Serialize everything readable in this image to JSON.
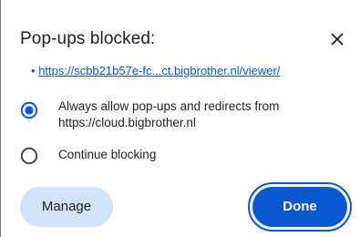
{
  "dialog": {
    "title": "Pop-ups blocked:",
    "close_icon": "close-icon",
    "blocked_link": {
      "bullet": "•",
      "text": "https://scbb21b57e-fc...ct.bigbrother.nl/viewer/"
    },
    "options": [
      {
        "line1": "Always allow pop-ups and redirects from",
        "line2": "https://cloud.bigbrother.nl",
        "selected": true
      },
      {
        "line1": "Continue blocking",
        "selected": false
      }
    ],
    "buttons": {
      "manage": "Manage",
      "done": "Done"
    }
  },
  "colors": {
    "accent": "#0b57d0",
    "secondary_button_bg": "#d3e3fd",
    "text": "#1f1f1f",
    "radio_unselected": "#444746"
  }
}
